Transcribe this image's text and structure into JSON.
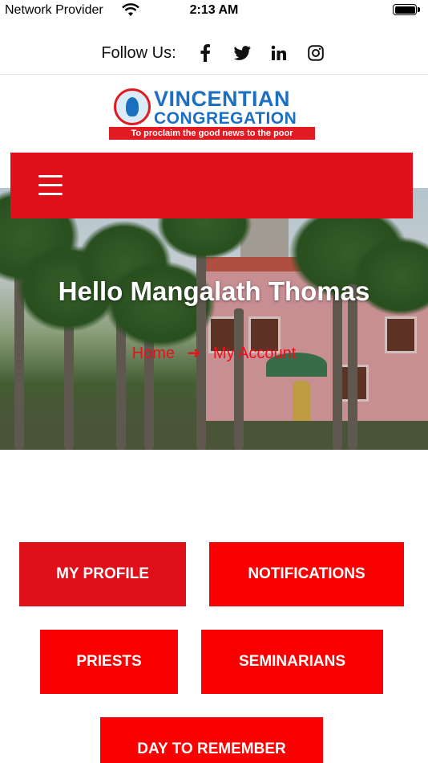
{
  "status_bar": {
    "carrier": "Network Provider",
    "time": "2:13 AM",
    "wifi_icon": "wifi-icon",
    "battery_icon": "battery-icon"
  },
  "follow": {
    "label": "Follow Us:",
    "icons": [
      "facebook-icon",
      "twitter-icon",
      "linkedin-icon",
      "instagram-icon"
    ]
  },
  "logo": {
    "line1": "VINCENTIAN",
    "line2": "CONGREGATION",
    "tagline": "To proclaim the good news to the poor"
  },
  "nav": {
    "menu_icon": "hamburger-menu-icon",
    "color": "#e0101a"
  },
  "hero": {
    "greeting": "Hello Mangalath Thomas",
    "breadcrumb_home": "Home",
    "breadcrumb_separator": "➜",
    "breadcrumb_current": "My Account"
  },
  "menu": {
    "my_profile": "MY PROFILE",
    "notifications": "NOTIFICATIONS",
    "priests": "PRIESTS",
    "seminarians": "SEMINARIANS",
    "day_to_remember": "DAY TO REMEMBER"
  },
  "colors": {
    "accent_red": "#fb0000",
    "active_red": "#e0101a",
    "brand_blue": "#1c6fc1"
  }
}
